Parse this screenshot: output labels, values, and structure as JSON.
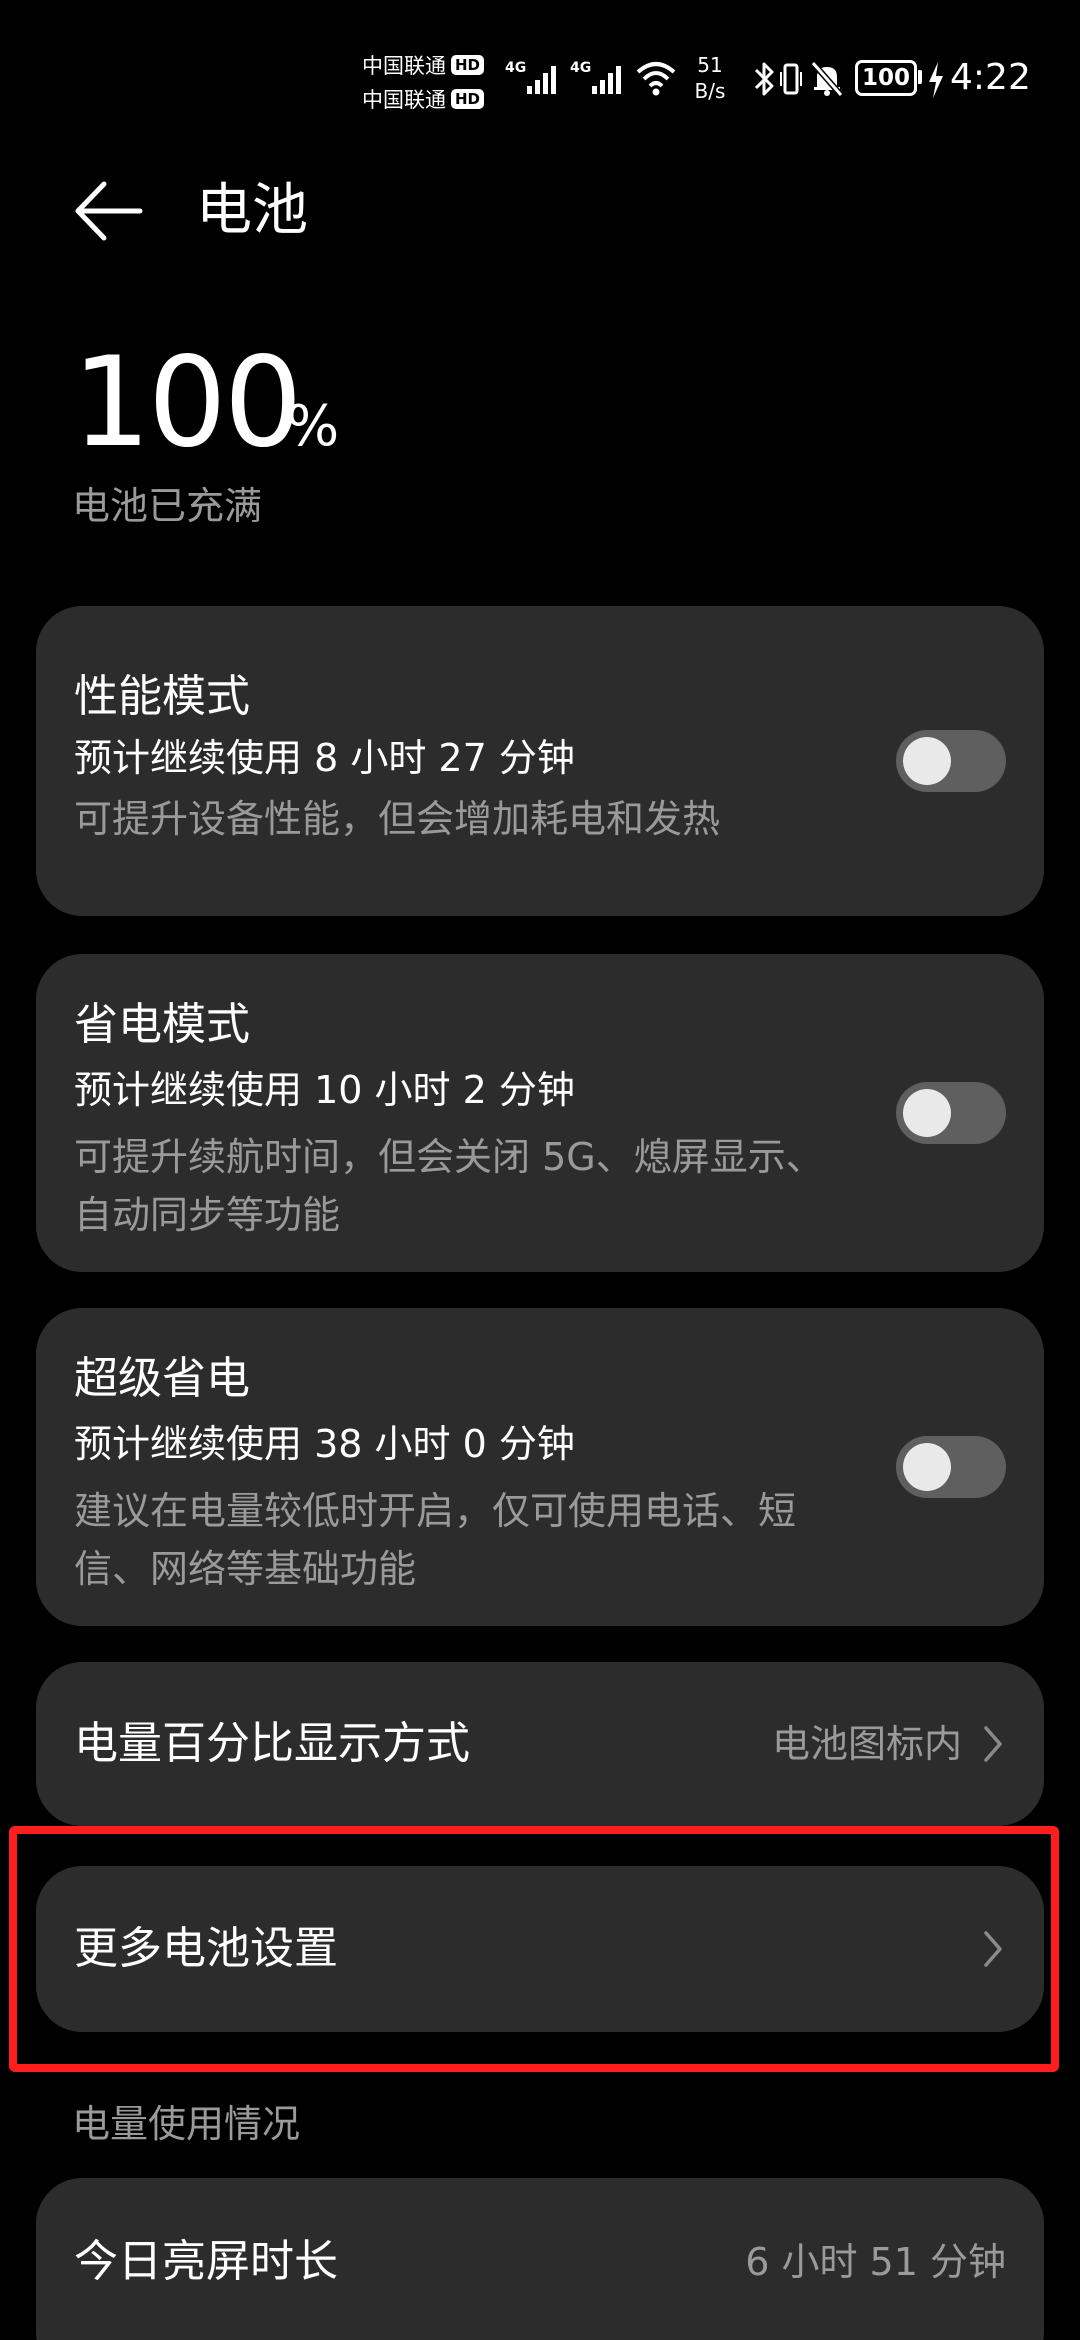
{
  "status_bar": {
    "carrier1": "中国联通",
    "carrier2": "中国联通",
    "hd_badge": "HD",
    "net_type": "4G",
    "speed_value": "51",
    "speed_unit": "B/s",
    "battery_level": "100",
    "time": "4:22"
  },
  "header": {
    "title": "电池"
  },
  "battery": {
    "percent": "100",
    "unit": "%",
    "status": "电池已充满"
  },
  "modes": [
    {
      "title": "性能模式",
      "estimate": "预计继续使用 8 小时 27 分钟",
      "description": "可提升设备性能，但会增加耗电和发热",
      "enabled": false
    },
    {
      "title": "省电模式",
      "estimate": "预计继续使用 10 小时 2 分钟",
      "description": "可提升续航时间，但会关闭 5G、熄屏显示、自动同步等功能",
      "enabled": false
    },
    {
      "title": "超级省电",
      "estimate": "预计继续使用 38 小时 0 分钟",
      "description": "建议在电量较低时开启，仅可使用电话、短信、网络等基础功能",
      "enabled": false
    }
  ],
  "percentage_display": {
    "label": "电量百分比显示方式",
    "value": "电池图标内"
  },
  "more_settings": {
    "label": "更多电池设置"
  },
  "usage": {
    "section_label": "电量使用情况",
    "screen_time_label": "今日亮屏时长",
    "screen_time_value": "6 小时 51 分钟"
  },
  "colors": {
    "background": "#000000",
    "card": "#2c2c2c",
    "secondary_text": "#9a9a9a",
    "highlight": "#ff1d1d"
  }
}
